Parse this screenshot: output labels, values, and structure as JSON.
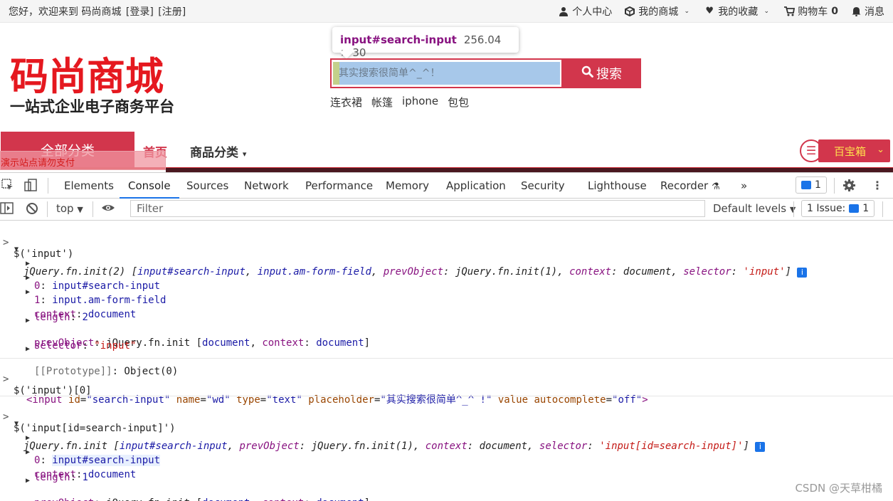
{
  "topbar": {
    "welcome": "您好，欢迎来到 码尚商城",
    "login": "[登录]",
    "register": "[注册]",
    "personal": "个人中心",
    "my_mall": "我的商城",
    "favorites": "我的收藏",
    "cart": "购物车",
    "cart_count": "0",
    "messages": "消息"
  },
  "logo": {
    "title": "码尚商城",
    "slogan": "一站式企业电子商务平台"
  },
  "tooltip": {
    "selector": "input#search-input",
    "size": "256.04 × 30"
  },
  "search": {
    "placeholder": "其实搜索很简单^_^！",
    "button": "搜索"
  },
  "hotwords": [
    "连衣裙",
    "帐篷",
    "iphone",
    "包包"
  ],
  "nav": {
    "all_categories": "全部分类",
    "home": "首页",
    "categories": "商品分类",
    "demo_notice": "演示站点请勿支付",
    "treasure": "百宝箱"
  },
  "devtools": {
    "tabs": [
      "Elements",
      "Console",
      "Sources",
      "Network",
      "Performance",
      "Memory",
      "Application",
      "Security",
      "Lighthouse",
      "Recorder"
    ],
    "active_tab": "Console",
    "message_count": "1",
    "context": "top",
    "filter_placeholder": "Filter",
    "levels": "Default levels",
    "issues_label": "1 Issue:",
    "issues_count": "1"
  },
  "console": {
    "cmd1": "$('input')",
    "cmd2": "$('input')[0]",
    "cmd3": "$('input[id=search-input]')"
  },
  "watermark": "CSDN @天草柑橘"
}
